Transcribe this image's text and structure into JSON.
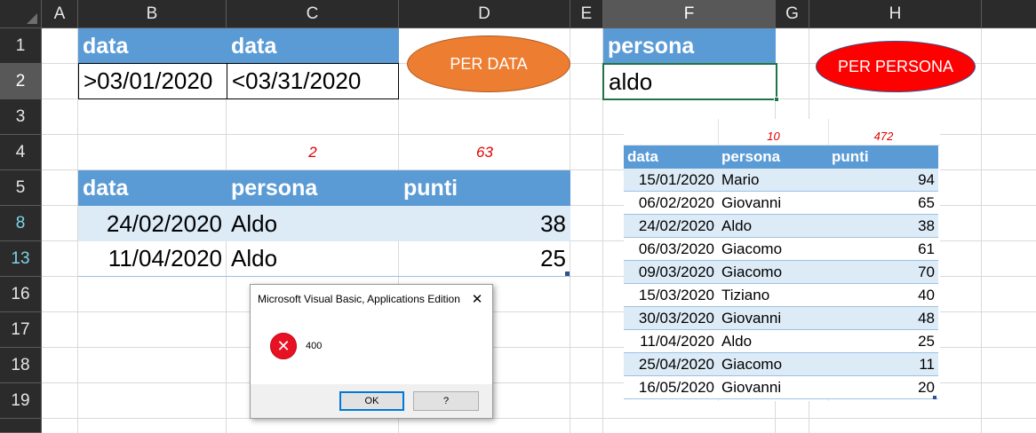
{
  "columns": [
    "A",
    "B",
    "C",
    "D",
    "E",
    "F",
    "G",
    "H"
  ],
  "rows": [
    "1",
    "2",
    "3",
    "4",
    "5",
    "8",
    "13",
    "16",
    "17",
    "18",
    "19"
  ],
  "criteria": {
    "b1": "data",
    "c1": "data",
    "b2": ">03/01/2020",
    "c2": "<03/31/2020",
    "f1": "persona",
    "f2": "aldo"
  },
  "buttons": {
    "per_data": "PER DATA",
    "per_persona": "PER PERSONA"
  },
  "result": {
    "count": "2",
    "sum": "63",
    "headers": [
      "data",
      "persona",
      "punti"
    ],
    "rows": [
      {
        "data": "24/02/2020",
        "persona": "Aldo",
        "punti": "38"
      },
      {
        "data": "11/04/2020",
        "persona": "Aldo",
        "punti": "25"
      }
    ]
  },
  "source": {
    "count": "10",
    "sum": "472",
    "headers": [
      "data",
      "persona",
      "punti"
    ],
    "rows": [
      {
        "data": "15/01/2020",
        "persona": "Mario",
        "punti": "94"
      },
      {
        "data": "06/02/2020",
        "persona": "Giovanni",
        "punti": "65"
      },
      {
        "data": "24/02/2020",
        "persona": "Aldo",
        "punti": "38"
      },
      {
        "data": "06/03/2020",
        "persona": "Giacomo",
        "punti": "61"
      },
      {
        "data": "09/03/2020",
        "persona": "Giacomo",
        "punti": "70"
      },
      {
        "data": "15/03/2020",
        "persona": "Tiziano",
        "punti": "40"
      },
      {
        "data": "30/03/2020",
        "persona": "Giovanni",
        "punti": "48"
      },
      {
        "data": "11/04/2020",
        "persona": "Aldo",
        "punti": "25"
      },
      {
        "data": "25/04/2020",
        "persona": "Giacomo",
        "punti": "11"
      },
      {
        "data": "16/05/2020",
        "persona": "Giovanni",
        "punti": "20"
      }
    ]
  },
  "dialog": {
    "title": "Microsoft Visual Basic, Applications Edition",
    "message": "400",
    "ok": "OK",
    "help": "?",
    "close_glyph": "✕",
    "error_glyph": "✕"
  },
  "colors": {
    "header_blue": "#5b9bd5",
    "band_blue": "#ddebf7",
    "per_data_orange": "#ed7d31",
    "per_persona_red": "#ff0000",
    "error_red": "#e81123"
  }
}
